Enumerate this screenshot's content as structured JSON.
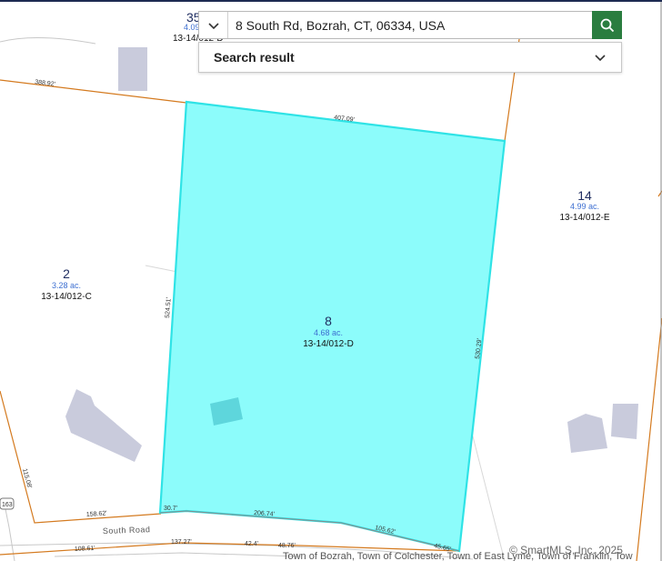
{
  "search": {
    "value": "8 South Rd, Bozrah, CT, 06334, USA"
  },
  "result_panel": {
    "title": "Search result"
  },
  "parcels": {
    "p35": {
      "number": "35",
      "acreage": "4.09",
      "id": "13-14/012-D"
    },
    "p14": {
      "number": "14",
      "acreage": "4.99 ac.",
      "id": "13-14/012-E"
    },
    "p2": {
      "number": "2",
      "acreage": "3.28 ac.",
      "id": "13-14/012-C"
    },
    "p8": {
      "number": "8",
      "acreage": "4.68 ac.",
      "id": "13-14/012-D"
    }
  },
  "dimensions": {
    "d1": "388.92'",
    "d2": "407.09'",
    "d3": "524.51'",
    "d4": "530.29'",
    "d5": "115.08'",
    "d6": "158.62'",
    "d7": "30.7'",
    "d8": "206.74'",
    "d9": "105.62'",
    "d10": "45.65'",
    "d11": "108.61'",
    "d12": "137.27'",
    "d13": "42.4'",
    "d14": "48.76'"
  },
  "road": {
    "name": "South Road",
    "shield": "163"
  },
  "footer": {
    "towns": "Town of Bozrah, Town of Colchester, Town of East Lyme, Town of Franklin, Tow",
    "copyright": "© SmartMLS, Inc. 2025"
  },
  "colors": {
    "selected_fill": "#8cfcfb",
    "selected_stroke": "#2fe3e6",
    "parcel_line": "#d47a1f",
    "building": "#c9cbdc",
    "search_button": "#2a7d3f"
  },
  "icons": {
    "dropdown": "chevron-down-icon",
    "clear": "close-icon",
    "search": "search-icon",
    "expand": "chevron-down-icon"
  }
}
